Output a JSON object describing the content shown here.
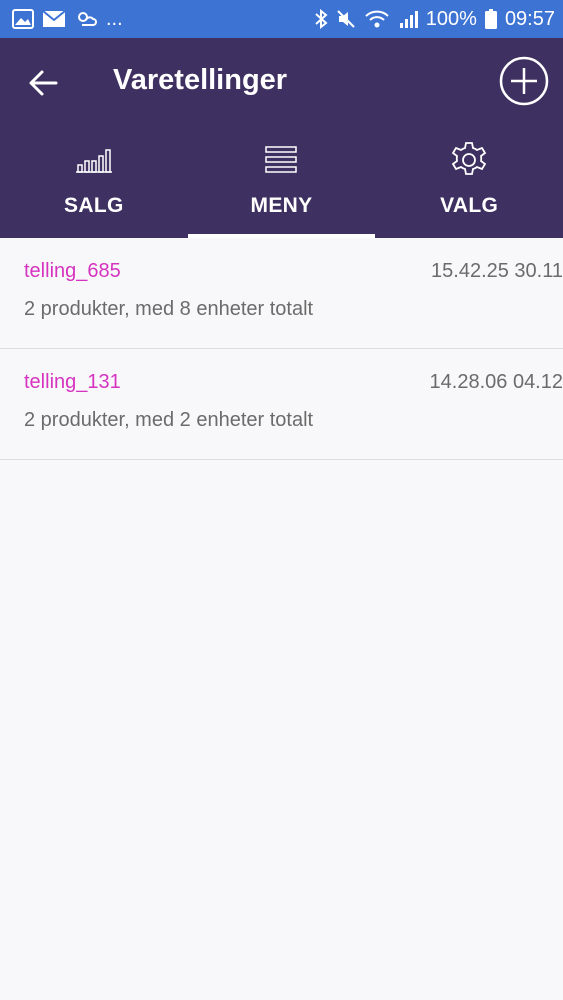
{
  "status_bar": {
    "left_icons": [
      "image-icon",
      "mail-icon",
      "weather-icon"
    ],
    "more": "...",
    "battery": "100%",
    "time": "09:57"
  },
  "header": {
    "title": "Varetellinger"
  },
  "tabs": [
    {
      "label": "SALG",
      "icon": "bar-chart-icon",
      "active": false
    },
    {
      "label": "MENY",
      "icon": "menu-lines-icon",
      "active": true
    },
    {
      "label": "VALG",
      "icon": "gear-icon",
      "active": false
    }
  ],
  "counts": [
    {
      "name": "telling_685",
      "date": "15.42.25 30.11",
      "summary": "2 produkter, med 8 enheter totalt"
    },
    {
      "name": "telling_131",
      "date": "14.28.06 04.12",
      "summary": "2 produkter, med 2 enheter totalt"
    }
  ],
  "colors": {
    "status_bar": "#3d74d4",
    "app_bar": "#3e3060",
    "accent_name": "#d633c0",
    "secondary_text": "#6b6b6b"
  }
}
